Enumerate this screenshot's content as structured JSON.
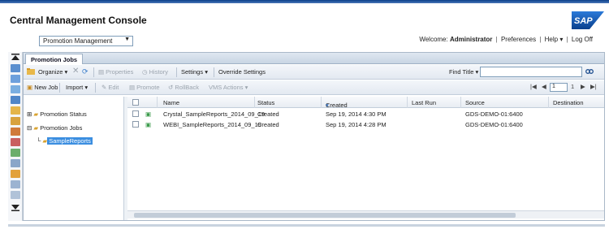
{
  "header": {
    "title": "Central Management Console",
    "logo_text": "SAP",
    "app_select": "Promotion Management",
    "welcome_label": "Welcome:",
    "user": "Administrator",
    "links": [
      "Preferences",
      "Help",
      "Log Off"
    ]
  },
  "tab": {
    "label": "Promotion Jobs"
  },
  "toolbar1": {
    "organize": "Organize",
    "properties": "Properties",
    "history": "History",
    "settings": "Settings",
    "override_settings": "Override Settings",
    "find_label": "Find Title"
  },
  "toolbar2": {
    "new_job": "New Job",
    "import": "Import",
    "edit": "Edit",
    "promote": "Promote",
    "rollback": "RollBack",
    "vms_actions": "VMS Actions",
    "page_value": "1",
    "page_total": "1"
  },
  "tree": {
    "items": [
      "Promotion Status",
      "Promotion Jobs",
      "SampleReports"
    ]
  },
  "grid": {
    "columns": [
      "Name",
      "Status",
      "Created",
      "Last Run",
      "Source",
      "Destination"
    ],
    "rows": [
      {
        "name": "Crystal_SampleReports_2014_09_19",
        "status": "Created",
        "created": "Sep 19, 2014 4:30 PM",
        "last_run": "",
        "source": "GDS-DEMO-01:6400",
        "destination": ""
      },
      {
        "name": "WEBI_SampleReports_2014_09_19",
        "status": "Created",
        "created": "Sep 19, 2014 4:28 PM",
        "last_run": "",
        "source": "GDS-DEMO-01:6400",
        "destination": ""
      }
    ]
  },
  "colors": {
    "accent": "#0b3f8a",
    "selection": "#3b8ee0"
  }
}
